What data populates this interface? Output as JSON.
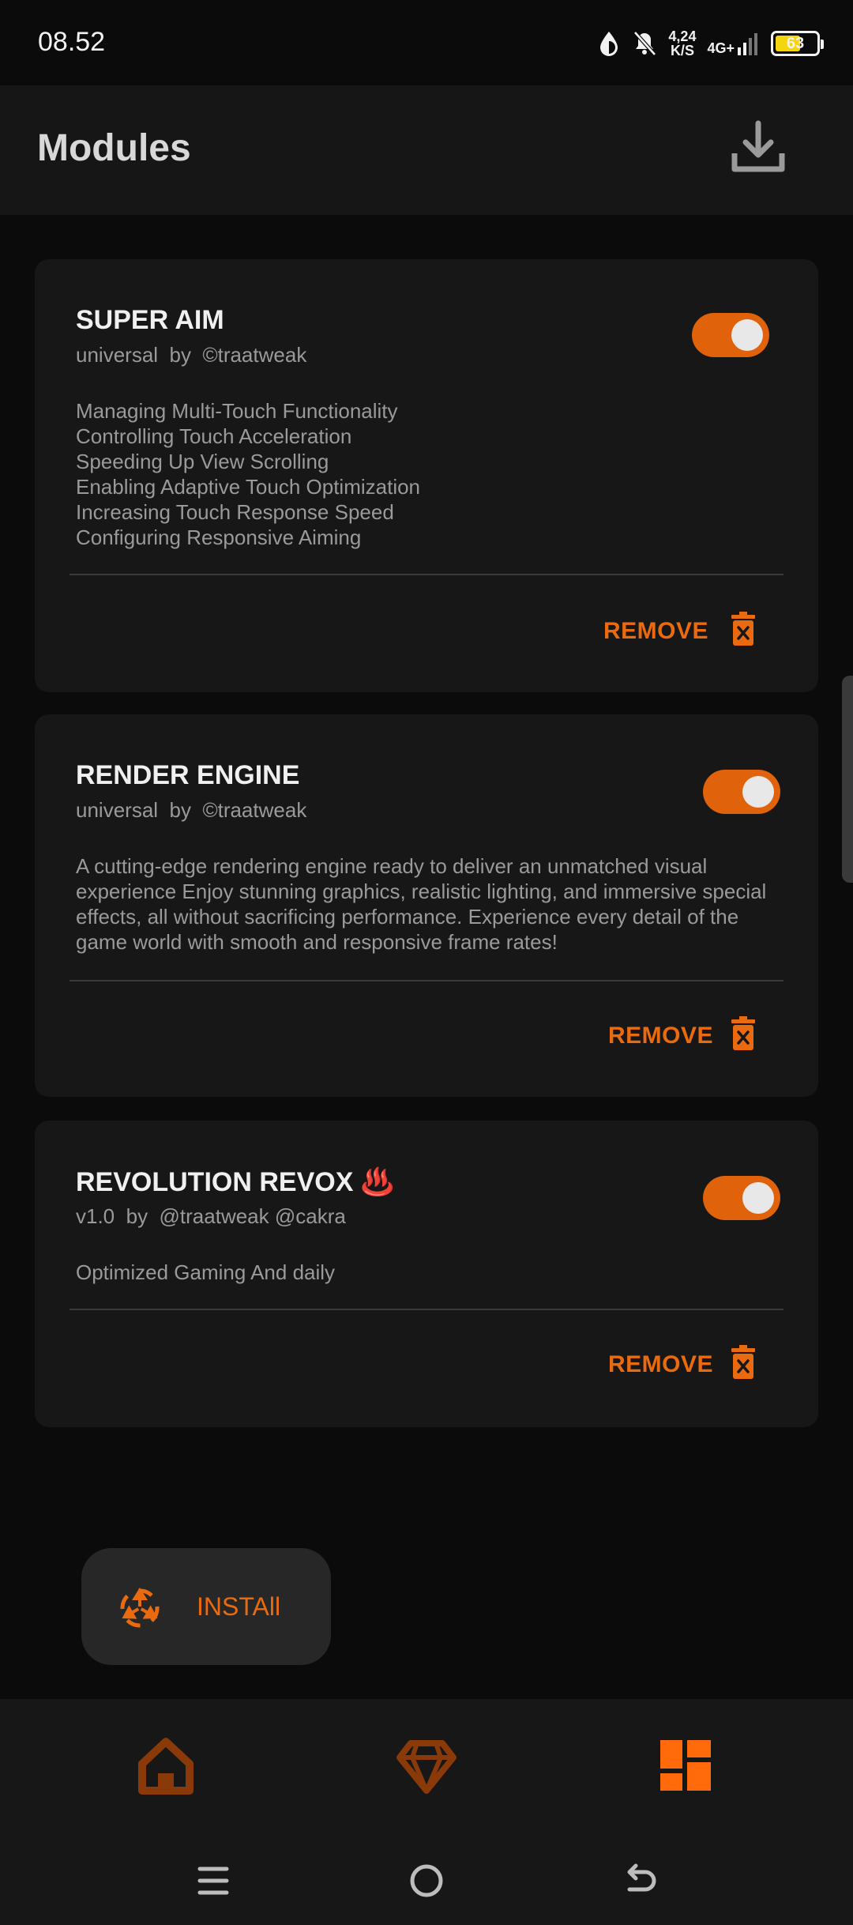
{
  "status_bar": {
    "time": "08.52",
    "net_speed_value": "4,24",
    "net_speed_unit": "K/S",
    "network": "4G+",
    "battery": "63",
    "battery_level_percent": 63
  },
  "app_bar": {
    "title": "Modules",
    "download_icon": "download-icon"
  },
  "modules": [
    {
      "title": "SUPER AIM",
      "version": "universal",
      "by": "by",
      "author": "©traatweak",
      "description": "Managing Multi-Touch Functionality\nControlling Touch Acceleration\nSpeeding Up View Scrolling\nEnabling Adaptive Touch Optimization\nIncreasing Touch Response Speed\nConfiguring Responsive Aiming",
      "enabled": true,
      "remove_label": "REMOVE"
    },
    {
      "title": "RENDER ENGINE",
      "version": "universal",
      "by": "by",
      "author": "©traatweak",
      "description": "A cutting-edge rendering engine ready to deliver an unmatched visual experience Enjoy stunning graphics, realistic lighting, and immersive special effects, all without sacrificing performance. Experience every detail of the game world with smooth and responsive frame rates!",
      "enabled": true,
      "remove_label": "REMOVE"
    },
    {
      "title": "REVOLUTION REVOX ♨️",
      "version": "v1.0",
      "by": "by",
      "author": "@traatweak @cakra",
      "description": "Optimized Gaming And daily",
      "enabled": true,
      "remove_label": "REMOVE"
    }
  ],
  "install_fab": {
    "label": "INSTAll",
    "icon": "recycle-icon"
  },
  "bottom_nav": {
    "items": [
      "home-icon",
      "diamond-icon",
      "modules-icon"
    ],
    "active": "modules-icon"
  },
  "system_nav": [
    "menu-icon",
    "home-circle-icon",
    "back-icon"
  ],
  "colors": {
    "accent": "#ea6a0f",
    "background": "#0b0b0b",
    "card": "#171717"
  }
}
